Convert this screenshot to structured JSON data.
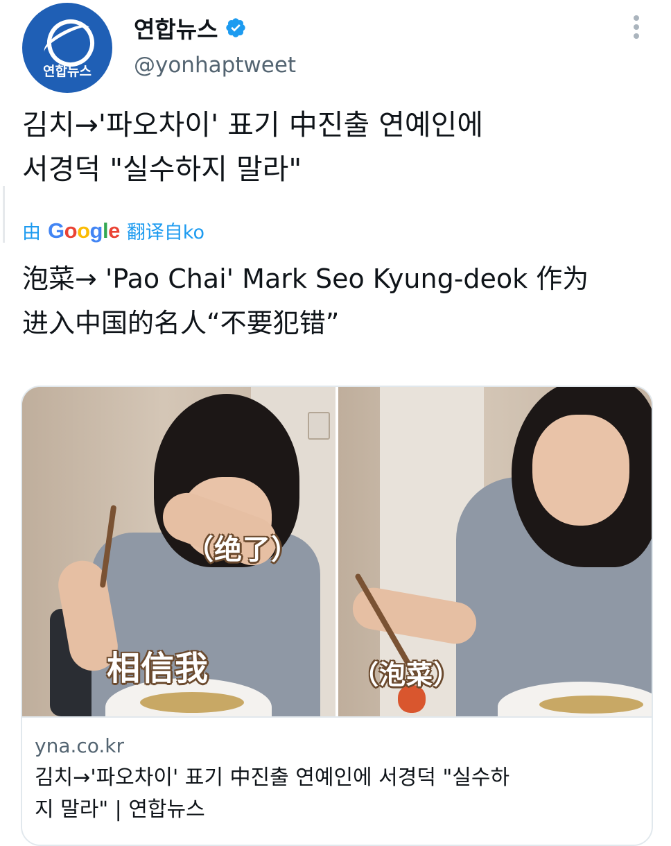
{
  "account": {
    "display_name": "연합뉴스",
    "handle": "@yonhaptweet",
    "avatar_label": "연합뉴스",
    "verified": true,
    "brand_color": "#1f5fb5"
  },
  "tweet": {
    "headline_ko_line1": "김치→'파오차이' 표기 中진출 연예인에",
    "headline_ko_line2": "서경덕 \"실수하지 말라\"",
    "translate_prefix": "由",
    "translate_brand": "Google",
    "translate_suffix": "翻译自ko",
    "headline_zh_line1": "泡菜→ 'Pao Chai' Mark Seo Kyung-deok 作为",
    "headline_zh_line2": "进入中国的名人“不要犯错”"
  },
  "card": {
    "image_captions": {
      "left_top": "（绝了）",
      "left_bottom": "相信我",
      "right_bottom": "（泡菜）"
    },
    "domain": "yna.co.kr",
    "title_line1": "김치→'파오차이' 표기 中진출 연예인에 서경덕 \"실수하",
    "title_line2": "지 말라\" | 연합뉴스"
  },
  "icons": {
    "verified": "verified-badge-icon",
    "more": "more-options-icon"
  },
  "colors": {
    "link_blue": "#1d9bf0",
    "verified_blue": "#1d9bf0",
    "secondary_text": "#536471"
  }
}
